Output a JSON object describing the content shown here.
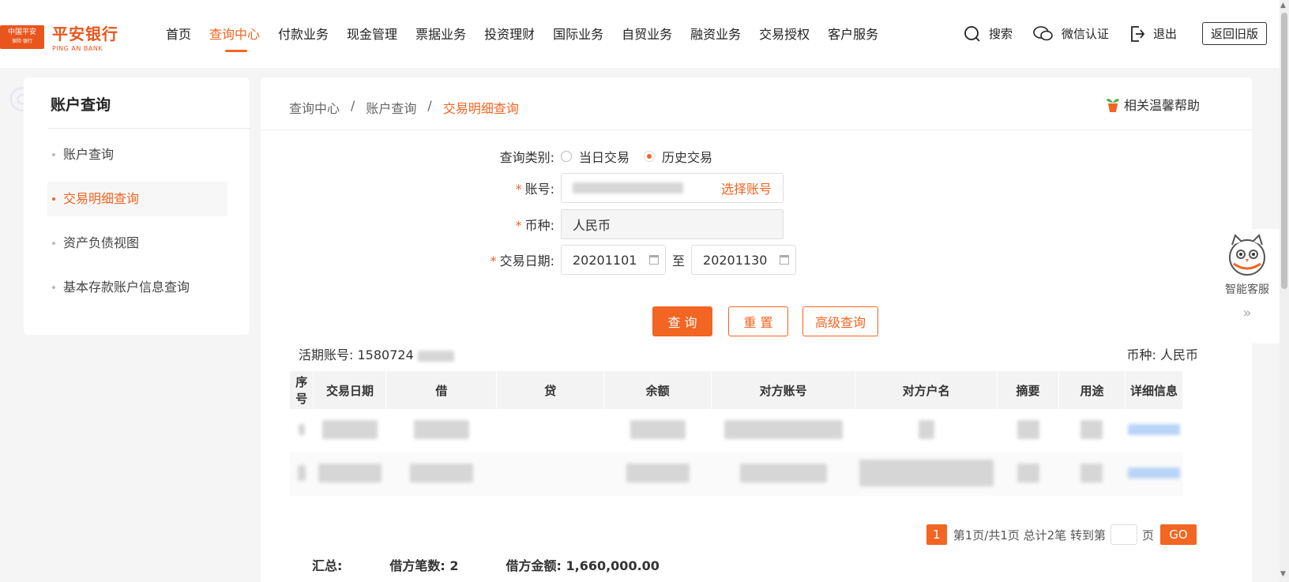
{
  "brand": {
    "logo_box_top": "中国平安",
    "logo_box_bottom": "保险·银行",
    "name_cn": "平安银行",
    "name_en": "PING AN BANK",
    "accent": "#f26522"
  },
  "nav": [
    "首页",
    "查询中心",
    "付款业务",
    "现金管理",
    "票据业务",
    "投资理财",
    "国际业务",
    "自贸业务",
    "融资业务",
    "交易授权",
    "客户服务"
  ],
  "tools": {
    "search": "搜索",
    "wechat": "微信认证",
    "logout": "退出",
    "old_version": "返回旧版"
  },
  "sidebar": {
    "title": "账户查询",
    "items": [
      "账户查询",
      "交易明细查询",
      "资产负债视图",
      "基本存款账户信息查询"
    ]
  },
  "breadcrumb": [
    "查询中心",
    "账户查询",
    "交易明细查询"
  ],
  "help": "相关温馨帮助",
  "form": {
    "query_type_label": "查询类别:",
    "radio_today": "当日交易",
    "radio_history": "历史交易",
    "account_label": "账号:",
    "select_account": "选择账号",
    "currency_label": "币种:",
    "currency_value": "人民币",
    "date_label": "交易日期:",
    "date_from": "20201101",
    "date_to_sep": "至",
    "date_to": "20201130"
  },
  "buttons": {
    "query": "查 询",
    "reset": "重 置",
    "advanced": "高级查询"
  },
  "account_info": {
    "label": "活期账号:",
    "value": "1580724",
    "currency_label": "币种:",
    "currency_value": "人民币"
  },
  "table": {
    "columns": [
      "序号",
      "交易日期",
      "借",
      "贷",
      "余额",
      "对方账号",
      "对方户名",
      "摘要",
      "用途",
      "详细信息"
    ]
  },
  "pager": {
    "current": "1",
    "info": "第1页/共1页 总计2笔 转到第",
    "page_suffix": "页",
    "go": "GO"
  },
  "summary": {
    "label": "汇总:",
    "debit_count": "借方笔数: 2",
    "debit_amount": "借方金额: 1,660,000.00"
  },
  "assistant": {
    "label": "智能客服",
    "chevron": "»"
  }
}
